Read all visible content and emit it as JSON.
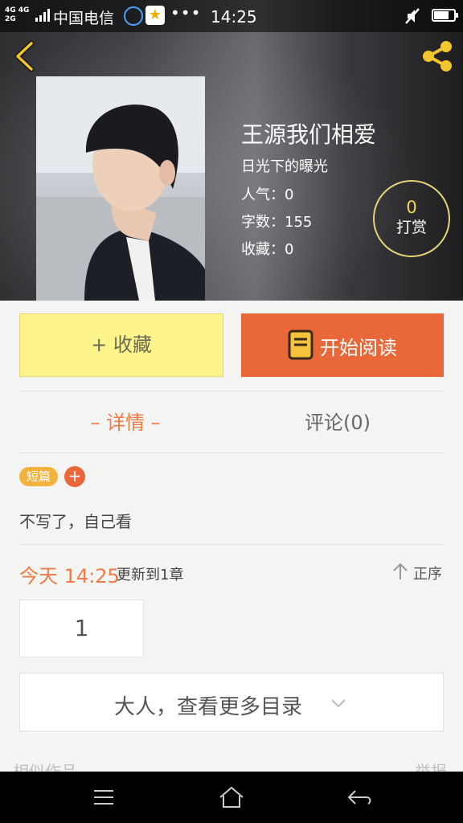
{
  "status_bar": {
    "network_top": "4G 4G",
    "network_bottom": "2G",
    "carrier": "中国电信",
    "dots": "•••",
    "time": "14:25",
    "battery_level": 0.75
  },
  "book": {
    "title": "王源我们相爱",
    "author": "日光下的曝光",
    "popularity": "人气：0",
    "word_count": "字数：155",
    "favorites": "收藏：0",
    "tip_count": "0",
    "tip_label": "打赏"
  },
  "actions": {
    "favorite_label": "+ 收藏",
    "read_label": "开始阅读"
  },
  "tabs": {
    "details": "– 详情 –",
    "comments": "评论(0)"
  },
  "detail": {
    "tag": "短篇",
    "add_tag": "+",
    "description": "不写了，自己看"
  },
  "update": {
    "time": "今天 14:25",
    "text": "更新到1章",
    "sort_label": "正序"
  },
  "chapters": {
    "first": "1",
    "more_label": "大人，查看更多目录"
  },
  "footer": {
    "similar_label": "相似作品",
    "report_label": "举报"
  },
  "colors": {
    "accent": "#e8683a",
    "accent_text": "#ee7b45",
    "favorite_bg": "#fdf48b",
    "tip_count": "#f7d64a"
  },
  "icons": [
    "back-icon",
    "share-icon",
    "book-icon",
    "sort-up-arrow-icon",
    "chevron-down-icon",
    "menu-icon",
    "home-icon",
    "back-nav-icon"
  ]
}
